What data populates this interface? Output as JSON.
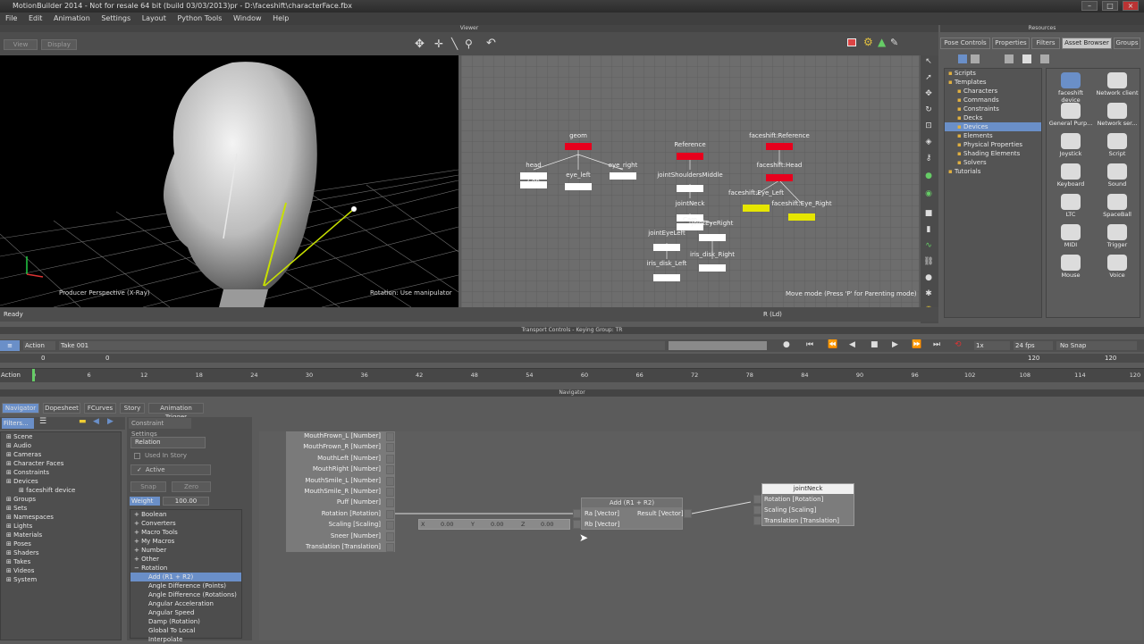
{
  "window": {
    "title": "MotionBuilder 2014 - Not for resale    64 bit (build 03/03/2013)pr  - D:\\faceshift\\characterFace.fbx"
  },
  "menu": [
    "File",
    "Edit",
    "Animation",
    "Settings",
    "Layout",
    "Python Tools",
    "Window",
    "Help"
  ],
  "panels": {
    "viewer": "Viewer",
    "resources": "Resources",
    "transport": "Transport Controls  -  Keying Group: TR",
    "navigator": "Navigator"
  },
  "viewer": {
    "tabs": [
      "View",
      "Display"
    ],
    "camera_label": "Producer Perspective (X-Ray)",
    "rotation_label": "Rotation: Use manipulator"
  },
  "schematic": {
    "mode_hint": "Move mode (Press 'P' for Parenting mode)",
    "status_right": "R (Ld)"
  },
  "schematic_nodes": [
    {
      "label": "geom",
      "color": "#e8001d"
    },
    {
      "label": "head",
      "color": "#ffffff"
    },
    {
      "label": "Con",
      "color": "#ffffff"
    },
    {
      "label": "eye_left",
      "color": "#ffffff"
    },
    {
      "label": "eye_right",
      "color": "#ffffff"
    },
    {
      "label": "Reference",
      "color": "#e8001d"
    },
    {
      "label": "jointShouldersMiddle",
      "color": "#ffffff"
    },
    {
      "label": "jointNeck",
      "color": "#ffffff"
    },
    {
      "label": "Cam",
      "color": "#ffffff"
    },
    {
      "label": "jointEyeLeft",
      "color": "#ffffff"
    },
    {
      "label": "jointEyeRight",
      "color": "#ffffff"
    },
    {
      "label": "iris_disk_Left",
      "color": "#ffffff"
    },
    {
      "label": "iris_disk_Right",
      "color": "#ffffff"
    },
    {
      "label": "faceshift:Reference",
      "color": "#e8001d"
    },
    {
      "label": "faceshift:Head",
      "color": "#e8001d"
    },
    {
      "label": "faceshift:Eye_Left",
      "color": "#e6e600"
    },
    {
      "label": "faceshift:Eye_Right",
      "color": "#e6e600"
    }
  ],
  "resources": {
    "tabs": [
      "Pose Controls",
      "Properties",
      "Filters",
      "Asset Browser",
      "Groups"
    ],
    "tree": [
      "Scripts",
      "Templates",
      "Characters",
      "Commands",
      "Constraints",
      "Decks",
      "Devices",
      "Elements",
      "Physical Properties",
      "Shading Elements",
      "Solvers",
      "Tutorials"
    ],
    "devices": [
      "faceshift device",
      "Network client",
      "General Purp...",
      "Network ser...",
      "Joystick",
      "Script",
      "Keyboard",
      "Sound",
      "LTC",
      "SpaceBall",
      "MIDI",
      "Trigger",
      "Mouse",
      "Voice"
    ]
  },
  "status": {
    "text": "Ready"
  },
  "transport": {
    "mode": "Action",
    "take": "Take 001",
    "fps": "24 fps",
    "snap": "No Snap",
    "speed": "1x",
    "start": "0",
    "end": "120",
    "current": "0",
    "end_field": "120",
    "row_label": "Action",
    "ticks": [
      "0",
      "6",
      "12",
      "18",
      "24",
      "30",
      "36",
      "42",
      "48",
      "54",
      "60",
      "66",
      "72",
      "78",
      "84",
      "90",
      "96",
      "102",
      "108",
      "114",
      "120"
    ]
  },
  "navigator": {
    "tabs": [
      "Navigator",
      "Dopesheet",
      "FCurves",
      "Story",
      "Animation Trigger"
    ],
    "settings_tab": "Constraint Settings",
    "filter_label": "Filters...",
    "tree": [
      "Scene",
      "Audio",
      "Cameras",
      "Character Faces",
      "Constraints",
      "Devices",
      "faceshift device",
      "Groups",
      "Sets",
      "Namespaces",
      "Lights",
      "Materials",
      "Poses",
      "Shaders",
      "Takes",
      "Videos",
      "System"
    ]
  },
  "constraint": {
    "name": "Relation",
    "used_in_story": "Used In Story",
    "active": "Active",
    "snap": "Snap",
    "zero": "Zero",
    "weight_label": "Weight",
    "weight_value": "100.00",
    "categories": [
      "Boolean",
      "Converters",
      "Macro Tools",
      "My Macros",
      "Number",
      "Other",
      "Rotation",
      "Add (R1 + R2)",
      "Angle Difference (Points)",
      "Angle Difference (Rotations)",
      "Angular Acceleration",
      "Angular Speed",
      "Damp (Rotation)",
      "Global To Local",
      "Interpolate"
    ]
  },
  "relation": {
    "source_outputs": [
      "MouthFrown_L [Number]",
      "MouthFrown_R [Number]",
      "MouthLeft [Number]",
      "MouthRight [Number]",
      "MouthSmile_L [Number]",
      "MouthSmile_R [Number]",
      "Puff [Number]",
      "Rotation [Rotation]",
      "Scaling [Scaling]",
      "Sneer [Number]",
      "Translation [Translation]"
    ],
    "vector_x": "0.00",
    "vector_y": "0.00",
    "vector_z": "0.00",
    "add_node": {
      "title": "Add (R1 + R2)",
      "inputs": [
        "Ra [Vector]",
        "Rb [Vector]"
      ],
      "output": "Result [Vector]"
    },
    "target_node": {
      "title": "jointNeck",
      "inputs": [
        "Rotation [Rotation]",
        "Scaling [Scaling]",
        "Translation [Translation]"
      ]
    }
  }
}
